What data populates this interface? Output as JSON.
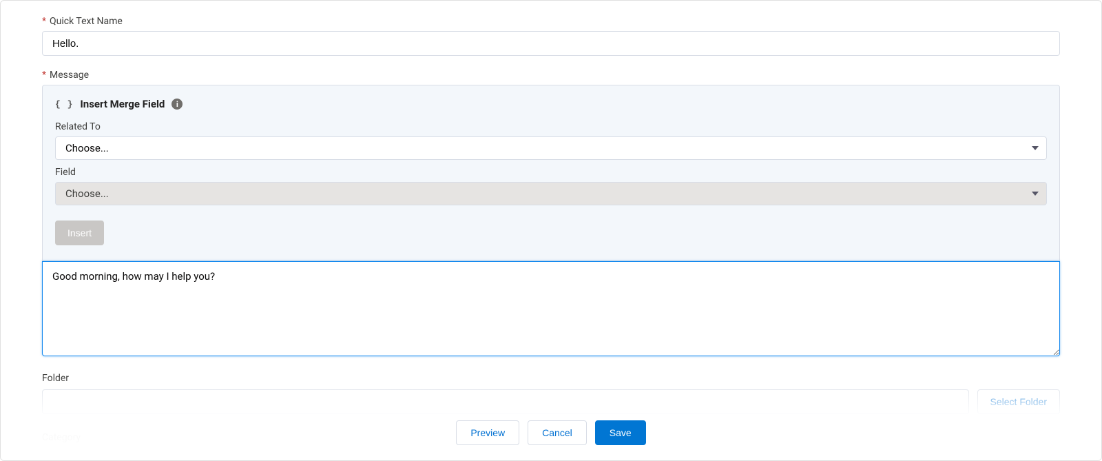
{
  "quick_text_name": {
    "label": "Quick Text Name",
    "value": "Hello."
  },
  "message": {
    "label": "Message",
    "merge_panel": {
      "title": "Insert Merge Field",
      "related_to": {
        "label": "Related To",
        "placeholder": "Choose..."
      },
      "field": {
        "label": "Field",
        "placeholder": "Choose..."
      },
      "insert_button": "Insert"
    },
    "value": "Good morning, how may I help you?"
  },
  "folder": {
    "label": "Folder",
    "select_button": "Select Folder"
  },
  "category": {
    "label": "Category"
  },
  "footer": {
    "preview": "Preview",
    "cancel": "Cancel",
    "save": "Save"
  }
}
